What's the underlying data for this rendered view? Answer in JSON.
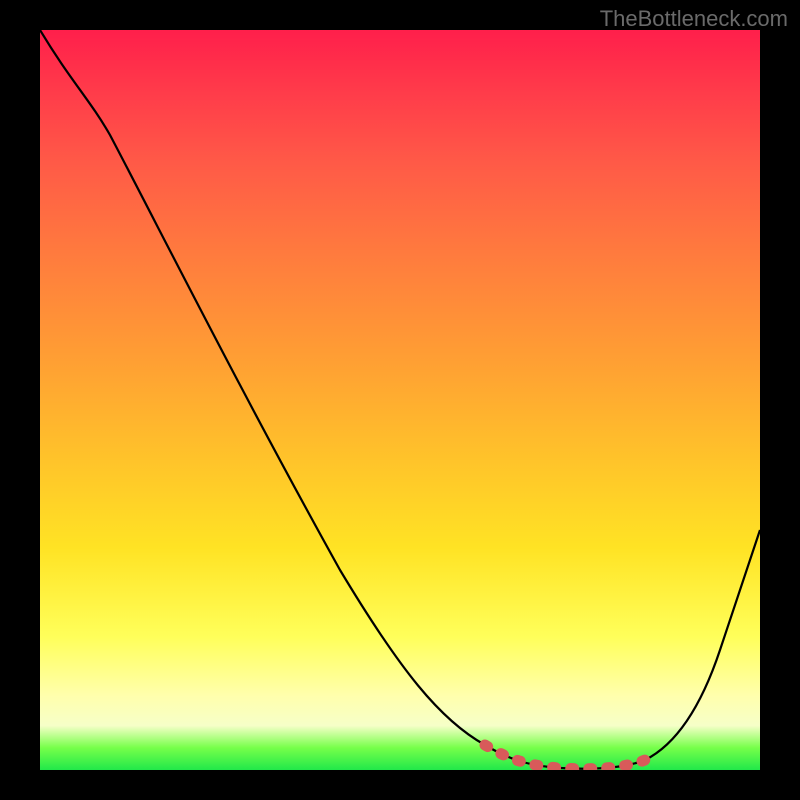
{
  "watermark": "TheBottleneck.com",
  "chart_data": {
    "type": "line",
    "title": "",
    "xlabel": "",
    "ylabel": "",
    "x": [
      0.0,
      0.05,
      0.1,
      0.15,
      0.2,
      0.25,
      0.3,
      0.35,
      0.4,
      0.45,
      0.5,
      0.55,
      0.6,
      0.65,
      0.7,
      0.75,
      0.8,
      0.85,
      0.9,
      0.95,
      1.0
    ],
    "values": [
      1.0,
      0.94,
      0.86,
      0.76,
      0.66,
      0.56,
      0.46,
      0.37,
      0.28,
      0.2,
      0.13,
      0.08,
      0.04,
      0.015,
      0.005,
      0.0,
      0.0,
      0.02,
      0.08,
      0.18,
      0.32
    ],
    "xlim": [
      0,
      1
    ],
    "ylim": [
      0,
      1
    ],
    "highlight_range": {
      "x_start": 0.62,
      "x_end": 0.82
    },
    "annotations": []
  },
  "colors": {
    "black": "#000000",
    "highlight": "#d85a5a"
  }
}
